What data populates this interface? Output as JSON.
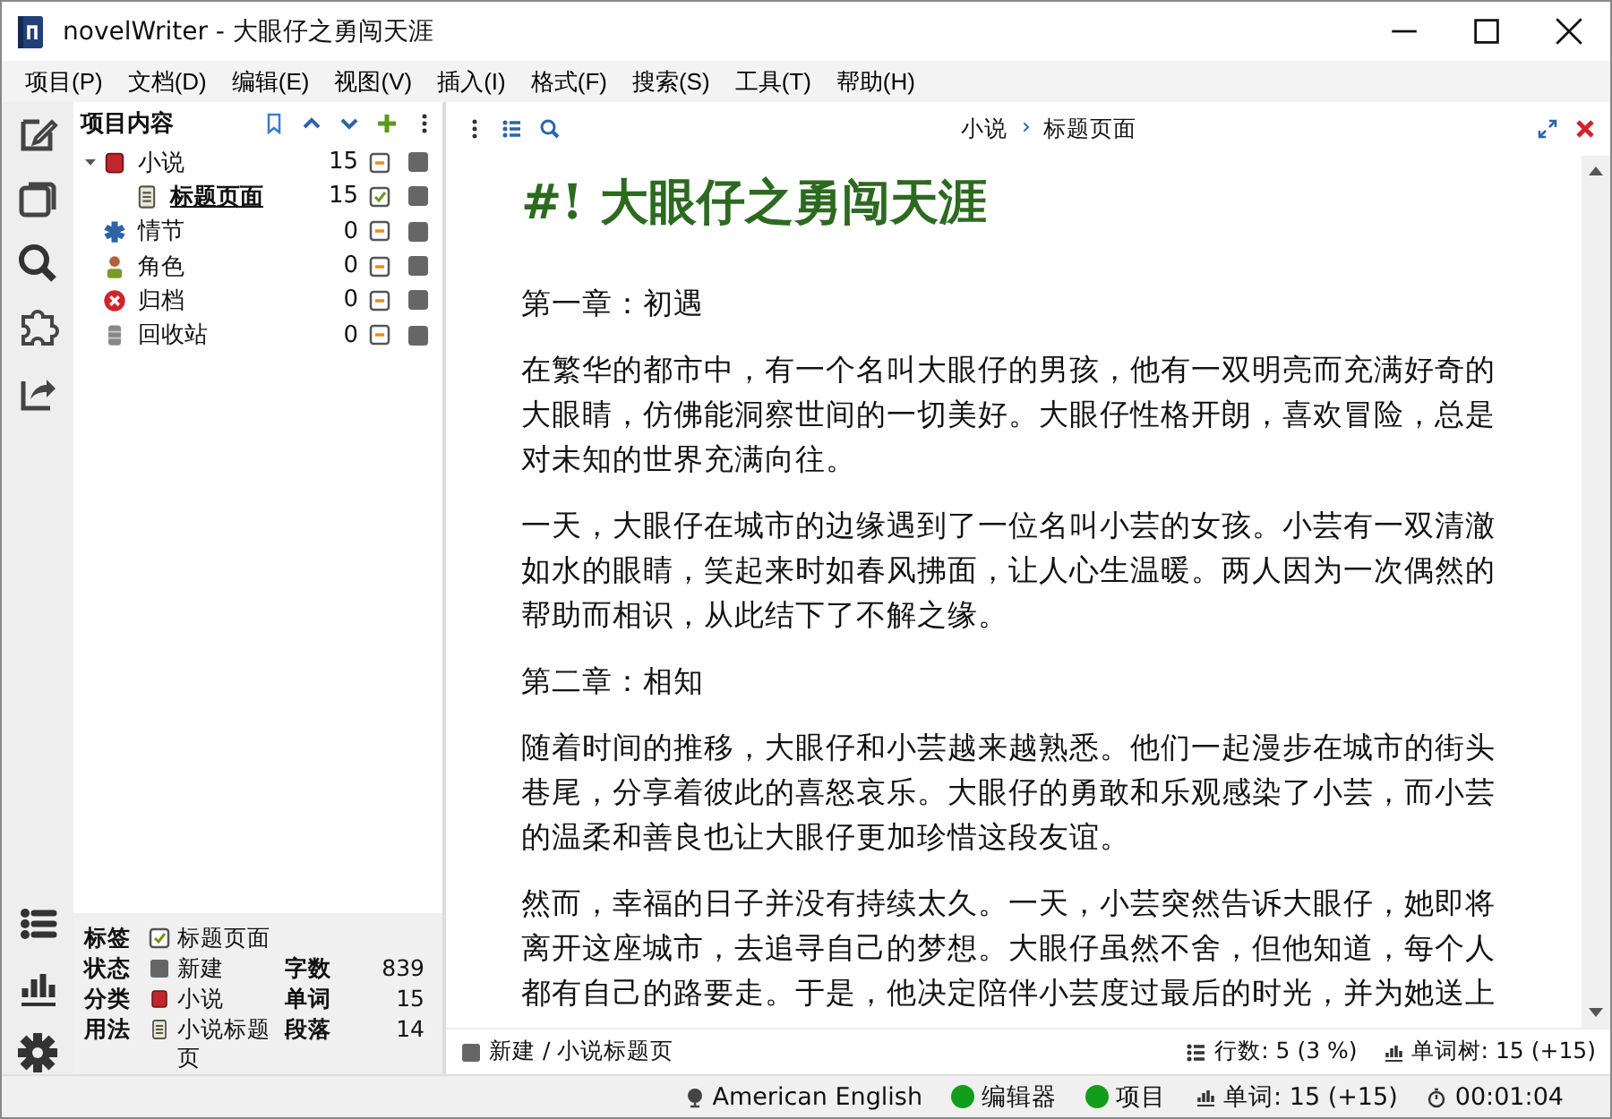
{
  "window": {
    "title": "novelWriter - 大眼仔之勇闯天涯"
  },
  "menu": [
    "项目(P)",
    "文档(D)",
    "编辑(E)",
    "视图(V)",
    "插入(I)",
    "格式(F)",
    "搜索(S)",
    "工具(T)",
    "帮助(H)"
  ],
  "project_tree": {
    "title": "项目内容",
    "items": [
      {
        "label": "小说",
        "kind": "novel",
        "count": "15",
        "done": false,
        "selected": false,
        "expanded": true,
        "children": [
          {
            "label": "标题页面",
            "kind": "document",
            "count": "15",
            "done": true,
            "selected": true
          }
        ]
      },
      {
        "label": "情节",
        "kind": "plot",
        "count": "0",
        "done": false,
        "selected": false
      },
      {
        "label": "角色",
        "kind": "character",
        "count": "0",
        "done": false,
        "selected": false
      },
      {
        "label": "归档",
        "kind": "archive",
        "count": "0",
        "done": false,
        "selected": false
      },
      {
        "label": "回收站",
        "kind": "trash",
        "count": "0",
        "done": false,
        "selected": false
      }
    ]
  },
  "details": {
    "rows": [
      {
        "label": "标签",
        "kind": "check",
        "value": "标题页面"
      },
      {
        "label": "状态",
        "kind": "status",
        "value": "新建",
        "stat_label": "字数",
        "stat_value": "839"
      },
      {
        "label": "分类",
        "kind": "novel",
        "value": "小说",
        "stat_label": "单词",
        "stat_value": "15"
      },
      {
        "label": "用法",
        "kind": "document",
        "value": "小说标题页",
        "stat_label": "段落",
        "stat_value": "14"
      }
    ]
  },
  "editor": {
    "breadcrumb": [
      "小说",
      "标题页面"
    ],
    "blocks": [
      {
        "kind": "title",
        "text": "#! 大眼仔之勇闯天涯"
      },
      {
        "kind": "text",
        "text": "第一章：初遇"
      },
      {
        "kind": "text",
        "text": "在繁华的都市中，有一个名叫大眼仔的男孩，他有一双明亮而充满好奇的大眼睛，仿佛能洞察世间的一切美好。大眼仔性格开朗，喜欢冒险，总是对未知的世界充满向往。"
      },
      {
        "kind": "text",
        "text": "一天，大眼仔在城市的边缘遇到了一位名叫小芸的女孩。小芸有一双清澈如水的眼睛，笑起来时如春风拂面，让人心生温暖。两人因为一次偶然的帮助而相识，从此结下了不解之缘。"
      },
      {
        "kind": "text",
        "text": "第二章：相知"
      },
      {
        "kind": "text",
        "text": "随着时间的推移，大眼仔和小芸越来越熟悉。他们一起漫步在城市的街头巷尾，分享着彼此的喜怒哀乐。大眼仔的勇敢和乐观感染了小芸，而小芸的温柔和善良也让大眼仔更加珍惜这段友谊。"
      },
      {
        "kind": "text",
        "text": "然而，幸福的日子并没有持续太久。一天，小芸突然告诉大眼仔，她即将离开这座城市，去追寻自己的梦想。大眼仔虽然不舍，但他知道，每个人都有自己的路要走。于是，他决定陪伴小芸度过最后的时光，并为她送上"
      }
    ],
    "footer": {
      "path": "新建 / 小说标题页",
      "lines": "行数: 5 (3 %)",
      "words": "单词树: 15 (+15)"
    }
  },
  "status_bar": {
    "language": "American English",
    "indicators": [
      {
        "label": "编辑器",
        "color": "#129d1a"
      },
      {
        "label": "项目",
        "color": "#129d1a"
      }
    ],
    "words": "单词: 15 (+15)",
    "time": "00:01:04"
  }
}
